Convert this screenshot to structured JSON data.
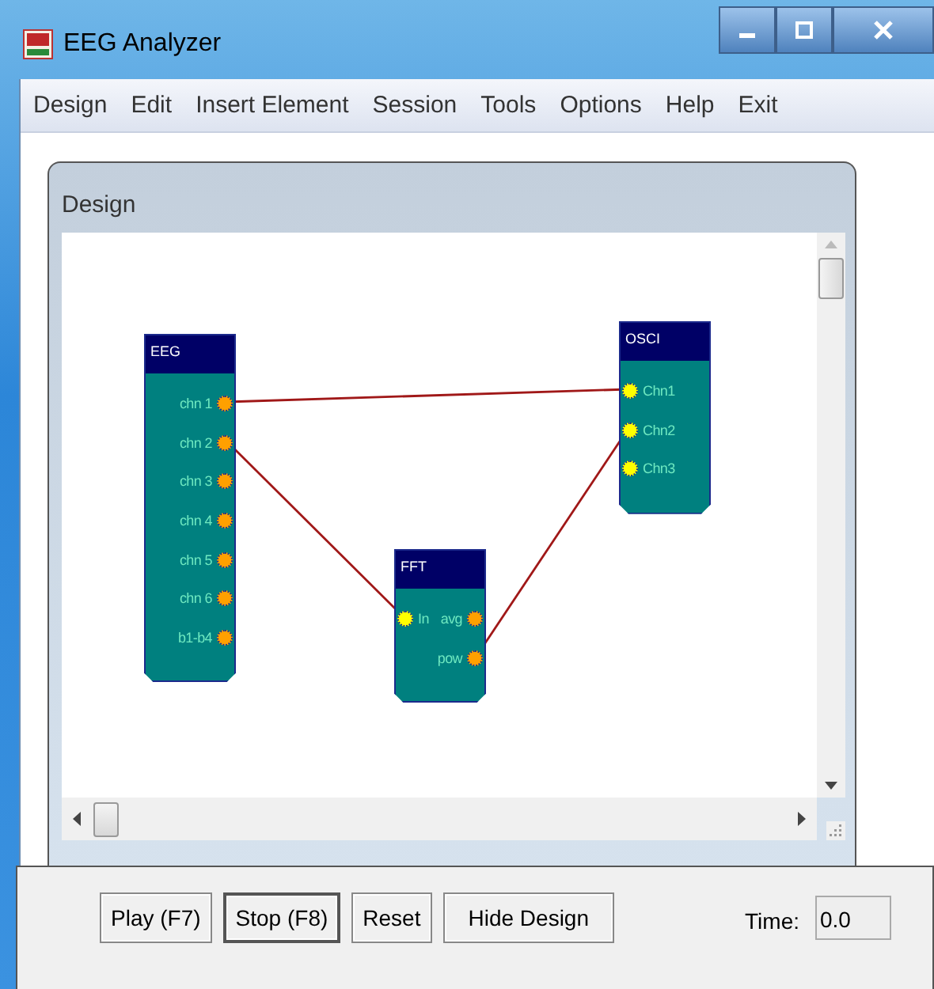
{
  "window": {
    "title": "EEG Analyzer"
  },
  "menu": [
    "Design",
    "Edit",
    "Insert Element",
    "Session",
    "Tools",
    "Options",
    "Help",
    "Exit"
  ],
  "panel": {
    "title": "Design"
  },
  "nodes": [
    {
      "title": "EEG",
      "outputs": [
        "chn 1",
        "chn 2",
        "chn 3",
        "chn 4",
        "chn 5",
        "chn 6",
        "b1-b4"
      ]
    },
    {
      "title": "OSCI",
      "inputs": [
        "Chn1",
        "Chn2",
        "Chn3"
      ]
    },
    {
      "title": "FFT",
      "inputs": [
        "In"
      ],
      "outputs": [
        "avg",
        "pow"
      ]
    }
  ],
  "buttons": [
    {
      "label": "Play (F7)",
      "focused": false
    },
    {
      "label": "Stop (F8)",
      "focused": true
    },
    {
      "label": "Reset",
      "focused": false
    },
    {
      "label": "Hide Design",
      "focused": false
    }
  ],
  "time": {
    "label": "Time:",
    "value": "0.0"
  }
}
